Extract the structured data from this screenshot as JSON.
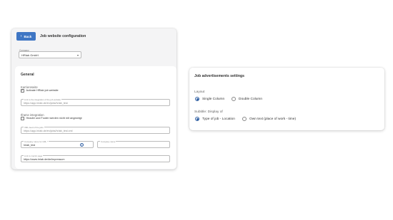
{
  "colors": {
    "accent": "#3f76c4",
    "radio_selected": "#2f5fa3"
  },
  "config": {
    "back_label": "Back",
    "title": "Job website configuration",
    "company": {
      "label": "Company",
      "value": "HRlab GmbH"
    }
  },
  "general": {
    "title": "General",
    "career_site": {
      "label": "Karriereseite",
      "checkbox_label": "Activate HRlab job website",
      "checked": true,
      "link_field": {
        "label": "Link to the integration of the job website",
        "value": "https://app.hrlab.de/en/jobs/hrlab_test"
      }
    },
    "iframe": {
      "label": "Iframe integration",
      "checkbox_label": "Header und Footer werden nicht mit angezeigt",
      "checked": false,
      "xml_field": {
        "label": "XML-feed of the jobs",
        "value": "https://app.hrlab.de/en/jobs/hrlab_test.xml"
      }
    },
    "company_url": {
      "label": "Company name for URL *",
      "value": "hrlab_test"
    },
    "company_name": {
      "label": "Company name",
      "value": ""
    },
    "imprint": {
      "label": "Link to imprint page",
      "value": "https://www.hrlab.de/de/impressum"
    }
  },
  "advertisement": {
    "title": "Job advertisements settings",
    "layout": {
      "label": "Layout",
      "options": [
        "Single Column",
        "Double Column"
      ],
      "selected": 0
    },
    "subtitle": {
      "label": "Subtitle: Display of",
      "options": [
        "Type of job - Location",
        "Own text (place of work - time)"
      ],
      "selected": 0
    }
  }
}
